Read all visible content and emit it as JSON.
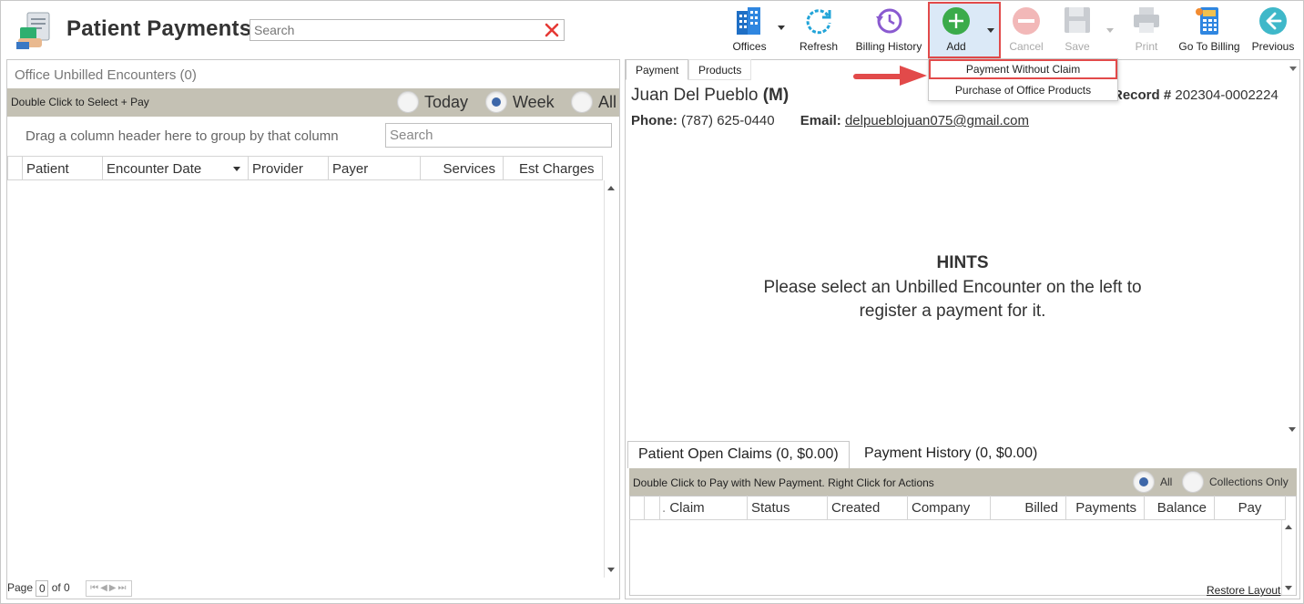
{
  "app": {
    "title": "Patient Payments",
    "search_placeholder": "Search"
  },
  "toolbar": {
    "offices": "Offices",
    "refresh": "Refresh",
    "billing_history": "Billing History",
    "add": "Add",
    "cancel": "Cancel",
    "save": "Save",
    "print": "Print",
    "go_to_billing": "Go To Billing",
    "previous": "Previous"
  },
  "add_menu": {
    "items": [
      "Payment Without Claim",
      "Purchase of Office Products"
    ]
  },
  "left": {
    "title": "Office Unbilled Encounters (0)",
    "bar_text": "Double Click to Select + Pay",
    "radios": [
      "Today",
      "Week",
      "All"
    ],
    "selected_radio": "Week",
    "drag_hint": "Drag a column header here to group by that column",
    "grid_search_placeholder": "Search",
    "columns": [
      "Patient",
      "Encounter Date",
      "Provider",
      "Payer",
      "Services",
      "Est Charges"
    ],
    "rows": [],
    "pager": {
      "page_label": "Page",
      "page": "0",
      "of": "of 0"
    }
  },
  "right": {
    "tabs": [
      "Payment",
      "Products"
    ],
    "active_tab": "Payment",
    "patient": {
      "name": "Juan Del Pueblo",
      "sex": "(M)",
      "record_label": "Record #",
      "record": "202304-0002224",
      "phone_label": "Phone:",
      "phone": "(787) 625-0440",
      "email_label": "Email:",
      "email": "delpueblojuan075@gmail.com"
    },
    "hints": {
      "title": "HINTS",
      "line1": "Please select an Unbilled Encounter on the left to",
      "line2": "register a payment for it."
    },
    "bottom_tabs": [
      "Patient Open Claims (0, $0.00)",
      "Payment History (0, $0.00)"
    ],
    "bar_text": "Double Click to Pay with New Payment. Right Click for Actions",
    "filters": [
      "All",
      "Collections Only"
    ],
    "selected_filter": "All",
    "columns": [
      "Claim",
      "Status",
      "Created",
      "Company",
      "Billed",
      "Payments",
      "Balance",
      "Pay"
    ],
    "rows": [],
    "restore_layout": "Restore Layout"
  },
  "colors": {
    "bar": "#c4c1b4",
    "highlight": "#e24a4a",
    "radio_selected": "#3e67a8",
    "add_green": "#3bab4a"
  }
}
